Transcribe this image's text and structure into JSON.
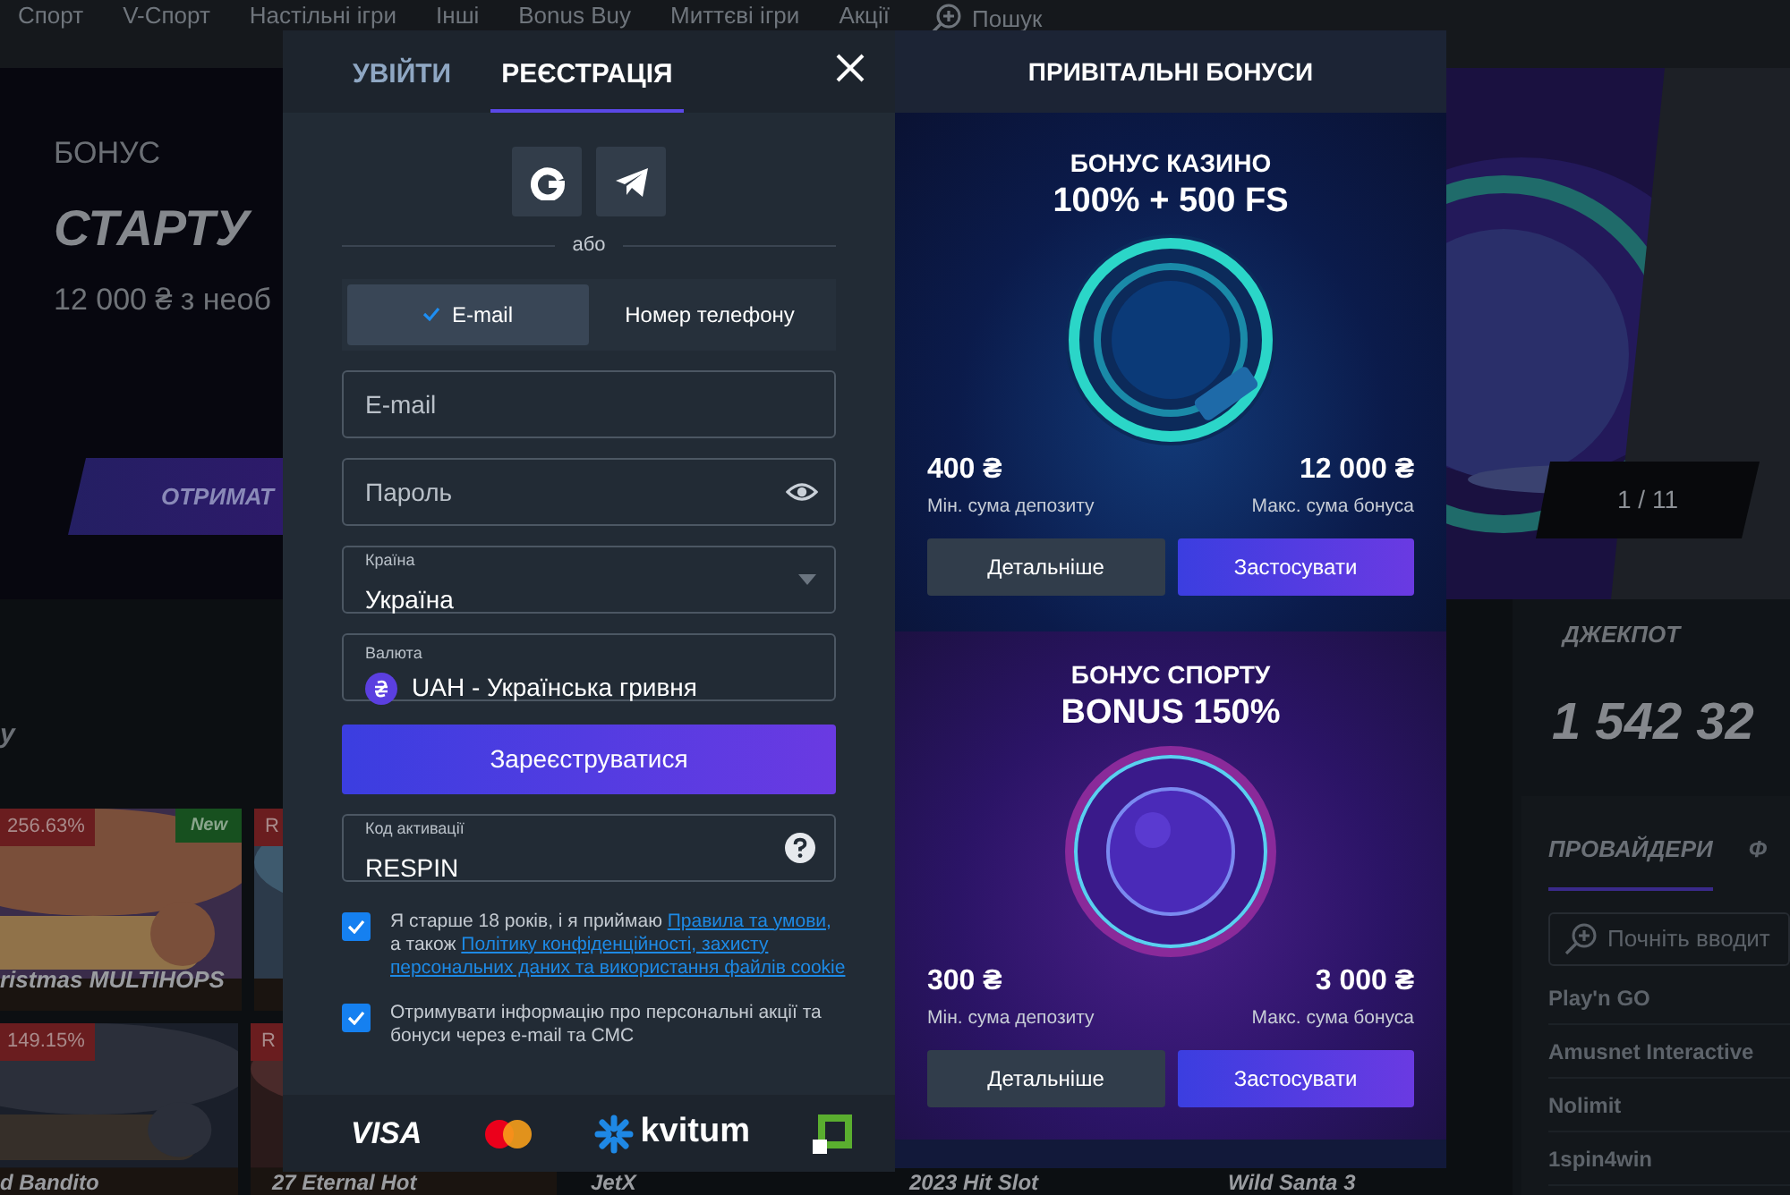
{
  "nav": {
    "items": [
      "Спорт",
      "V-Спорт",
      "Настільні ігри",
      "Інші",
      "Bonus Buy",
      "Миттєві ігри",
      "Акції"
    ],
    "search": "Пошук"
  },
  "hero": {
    "label": "БОНУС",
    "title": "СТАРТУ",
    "subtitle": "12 000 ₴ з необ",
    "button": "ОТРИМАТ",
    "counter": "1 / 11"
  },
  "games": {
    "heading": "у",
    "rows": [
      [
        {
          "badge": "256.63%",
          "tag": "New",
          "title": "ristmas MULTIHOPS"
        },
        {
          "badge": "R"
        }
      ],
      [
        {
          "badge": "149.15%",
          "title": "d Bandito"
        },
        {
          "badge": "R",
          "title": "27 Eternal Hot"
        },
        {
          "title": "JetX"
        },
        {
          "title": "2023 Hit Slot"
        },
        {
          "title": "Wild Santa 3"
        }
      ]
    ]
  },
  "jackpot": {
    "label": "ДЖЕКПОТ",
    "amount": "1 542 32"
  },
  "providers": {
    "tabs": [
      {
        "label": "ПРОВАЙДЕРИ",
        "selected": true
      },
      {
        "label": "Ф",
        "selected": false
      }
    ],
    "search": {
      "placeholder": "Почніть вводит"
    },
    "items": [
      "Play'n GO",
      "Amusnet Interactive",
      "Nolimit",
      "1spin4win"
    ]
  },
  "modal": {
    "tabs": [
      {
        "label": "УВІЙТИ",
        "selected": false
      },
      {
        "label": "РЕЄСТРАЦІЯ",
        "selected": true
      }
    ],
    "divider": "або",
    "methods": [
      {
        "label": "E-mail",
        "selected": true
      },
      {
        "label": "Номер телефону",
        "selected": false
      }
    ],
    "email": {
      "placeholder": "E-mail"
    },
    "password": {
      "placeholder": "Пароль"
    },
    "country": {
      "label": "Країна",
      "value": "Україна"
    },
    "currency": {
      "label": "Валюта",
      "value": "UAH - Українська гривня"
    },
    "submit": "Зареєструватися",
    "promo": {
      "label": "Код активації",
      "value": "RESPIN"
    },
    "consents": [
      {
        "checked": true,
        "parts": [
          {
            "kind": "text",
            "text": "Я старше 18 років, і я приймаю "
          },
          {
            "kind": "link",
            "text": "Правила та умови,"
          },
          {
            "kind": "text",
            "text": " а також "
          },
          {
            "kind": "link",
            "text": "Політику конфіденційності, захисту"
          },
          {
            "kind": "link",
            "text": "персональних даних та використання файлів cookie"
          }
        ]
      },
      {
        "checked": true,
        "parts": [
          {
            "kind": "text",
            "text": "Отримувати інформацію про персональні акції та бонуси через e-mail та СМС"
          }
        ]
      }
    ],
    "payments": {
      "visa": "VISA",
      "kvitum": "kvitum"
    }
  },
  "bonuses": {
    "title": "ПРИВІТАЛЬНІ БОНУСИ",
    "cards": [
      {
        "kind": "casino",
        "title": "БОНУС КАЗИНО",
        "offer": "100% + 500 FS",
        "min_amount": "400 ₴",
        "min_label": "Мін. сума депозиту",
        "max_amount": "12 000 ₴",
        "max_label": "Макс. сума бонуса",
        "details": "Детальніше",
        "apply": "Застосувати"
      },
      {
        "kind": "sport",
        "title": "БОНУС СПОРТУ",
        "offer": "BONUS 150%",
        "min_amount": "300 ₴",
        "min_label": "Мін. сума депозиту",
        "max_amount": "3 000 ₴",
        "max_label": "Макс. сума бонуса",
        "details": "Детальніше",
        "apply": "Застосувати"
      }
    ]
  }
}
